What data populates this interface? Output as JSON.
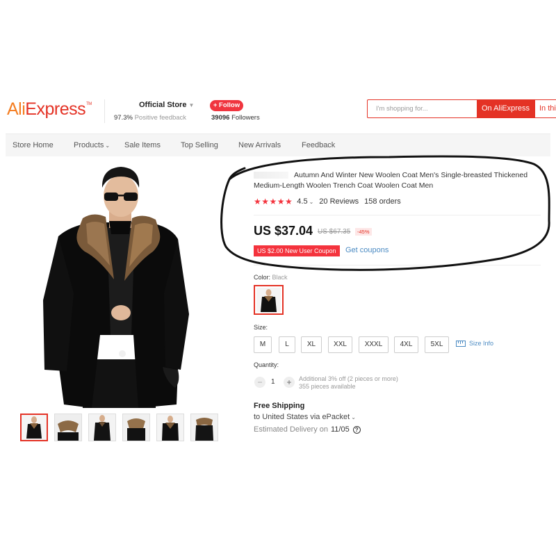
{
  "header": {
    "logo": {
      "part1": "Ali",
      "part2": "Express",
      "tm": "TM"
    },
    "store": {
      "name": "Official Store",
      "feedback_pct": "97.3%",
      "feedback_label": "Positive feedback",
      "follow_label": "+ Follow",
      "followers_count": "39096",
      "followers_label": "Followers"
    },
    "search": {
      "placeholder": "I'm shopping for...",
      "on_aliexpress_label": "On AliExpress",
      "in_store_label": "In this store"
    }
  },
  "nav": {
    "items": [
      {
        "label": "Store Home"
      },
      {
        "label": "Products"
      },
      {
        "label": "Sale Items"
      },
      {
        "label": "Top Selling"
      },
      {
        "label": "New Arrivals"
      },
      {
        "label": "Feedback"
      }
    ]
  },
  "product": {
    "title_line1": "Autumn And Winter New Woolen Coat Men's Single-breasted Thickened",
    "title_line2": "Medium-Length Woolen Trench Coat Woolen Coat Men",
    "stars": "★★★★★",
    "rating": "4.5",
    "reviews": "20 Reviews",
    "orders": "158 orders",
    "price": "US $37.04",
    "original_price": "US $67.35",
    "discount": "-45%",
    "coupon": "US $2.00 New User Coupon",
    "get_coupons": "Get coupons",
    "thumbnail_count": 6,
    "color": {
      "label": "Color:",
      "value": "Black"
    },
    "size": {
      "label": "Size:",
      "options": [
        "M",
        "L",
        "XL",
        "XXL",
        "XXXL",
        "4XL",
        "5XL"
      ],
      "info_label": "Size Info"
    },
    "quantity": {
      "label": "Quantity:",
      "value": "1",
      "minus": "−",
      "plus": "+",
      "note1": "Additional 3% off (2 pieces or more)",
      "note2": "355 pieces available"
    },
    "shipping": {
      "title": "Free Shipping",
      "to": "to United States via ePacket",
      "delivery_label": "Estimated Delivery on",
      "delivery_date": "11/05",
      "help": "?"
    }
  },
  "icons": {
    "chevron": "chevron-down-icon",
    "help": "question-circle-icon",
    "ruler": "ruler-icon",
    "star": "star-icon"
  },
  "colors": {
    "brand_red": "#e43225",
    "brand_orange": "#f47c1f",
    "star_red": "#f4333d",
    "link_blue": "#4a8ac2"
  }
}
